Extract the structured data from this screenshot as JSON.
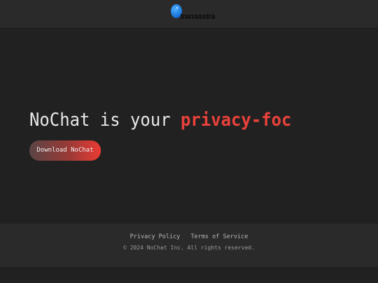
{
  "header": {
    "logo": {
      "text": "transastra",
      "icon": "globe-star-icon",
      "star_glyph": "✦"
    }
  },
  "hero": {
    "title_prefix": "NoChat is your ",
    "title_accent": "privacy-foc",
    "download_label": "Download NoChat"
  },
  "footer": {
    "links": [
      {
        "label": "Privacy Policy"
      },
      {
        "label": "Terms of Service"
      }
    ],
    "copyright": "© 2024 NoChat Inc. All rights reserved."
  },
  "colors": {
    "background": "#212121",
    "header_footer": "#2a2a2a",
    "accent": "#e8413b",
    "text": "#e8e8e8",
    "logo_blue": "#1e7de0"
  }
}
